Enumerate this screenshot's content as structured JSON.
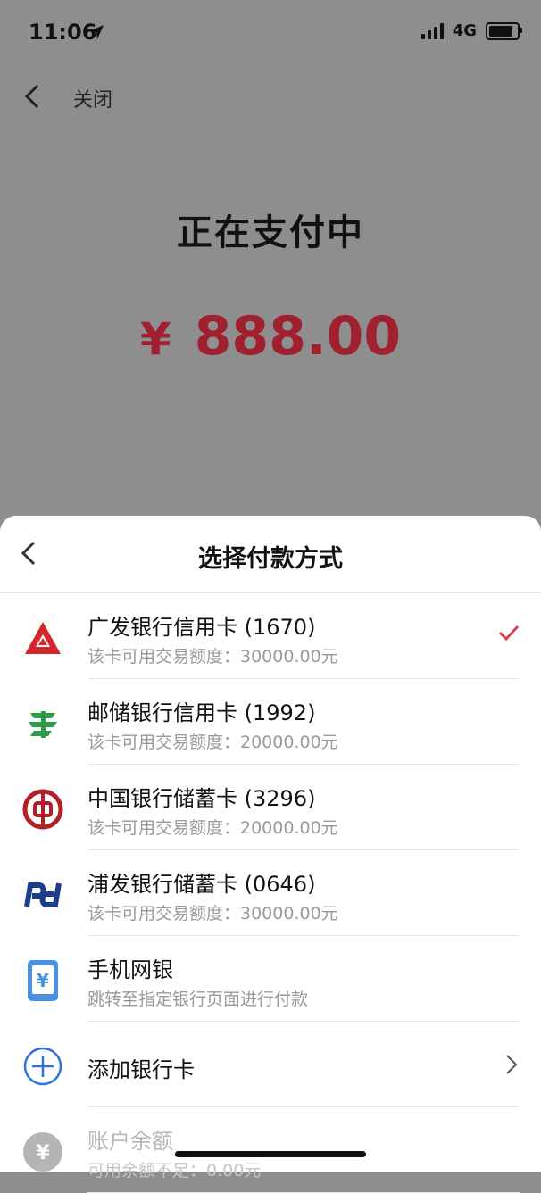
{
  "status_bar": {
    "time": "11:06",
    "network": "4G"
  },
  "nav": {
    "close_label": "关闭"
  },
  "payment": {
    "title": "正在支付中",
    "currency": "¥",
    "amount": "888.00"
  },
  "sheet": {
    "title": "选择付款方式",
    "methods": [
      {
        "name": "广发银行信用卡 (1670)",
        "sub": "该卡可用交易额度：30000.00元",
        "selected": true
      },
      {
        "name": "邮储银行信用卡 (1992)",
        "sub": "该卡可用交易额度：20000.00元"
      },
      {
        "name": "中国银行储蓄卡 (3296)",
        "sub": "该卡可用交易额度：20000.00元"
      },
      {
        "name": "浦发银行储蓄卡 (0646)",
        "sub": "该卡可用交易额度：30000.00元"
      },
      {
        "name": "手机网银",
        "sub": "跳转至指定银行页面进行付款"
      },
      {
        "name": "添加银行卡"
      },
      {
        "name": "账户余额",
        "sub": "可用余额不足：0.00元",
        "disabled": true
      }
    ]
  },
  "colors": {
    "accent": "#e03c4e",
    "amount": "#a02030",
    "add_icon": "#2b72e0"
  }
}
